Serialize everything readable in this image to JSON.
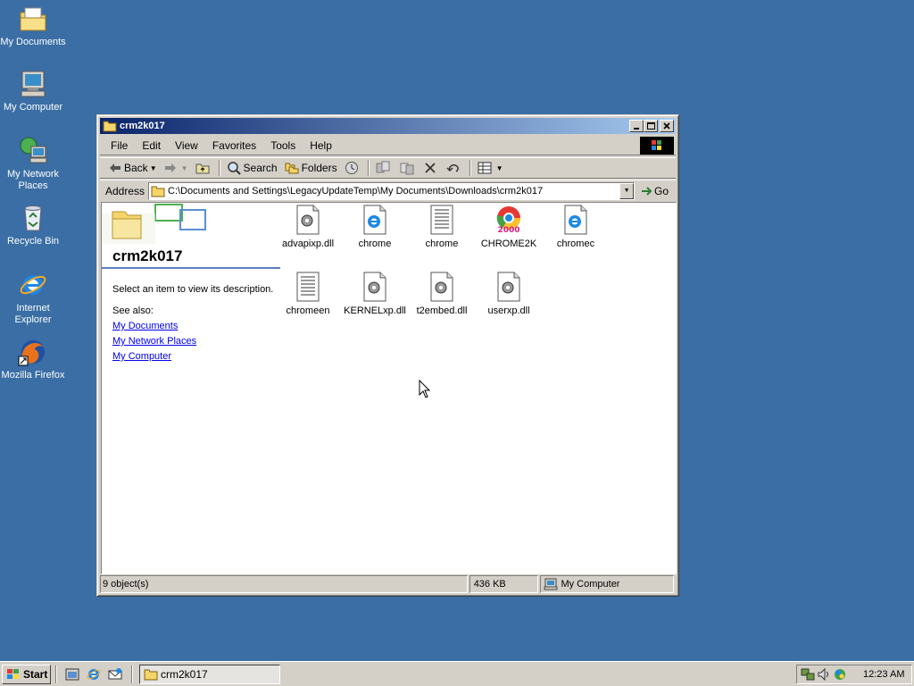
{
  "desktop": {
    "icons": [
      {
        "label": "My Documents",
        "icon": "my-documents-icon"
      },
      {
        "label": "My Computer",
        "icon": "my-computer-icon"
      },
      {
        "label": "My Network Places",
        "icon": "network-places-icon"
      },
      {
        "label": "Recycle Bin",
        "icon": "recycle-bin-icon"
      },
      {
        "label": "Internet Explorer",
        "icon": "internet-explorer-icon"
      },
      {
        "label": "Mozilla Firefox",
        "icon": "firefox-icon"
      }
    ]
  },
  "window": {
    "title": "crm2k017",
    "menu": [
      "File",
      "Edit",
      "View",
      "Favorites",
      "Tools",
      "Help"
    ],
    "toolbar": {
      "back": "Back",
      "search": "Search",
      "folders": "Folders"
    },
    "address": {
      "label": "Address",
      "value": "C:\\Documents and Settings\\LegacyUpdateTemp\\My Documents\\Downloads\\crm2k017",
      "go": "Go"
    },
    "leftpane": {
      "title": "crm2k017",
      "description": "Select an item to view its description.",
      "see_also": "See also:",
      "links": [
        "My Documents",
        "My Network Places",
        "My Computer"
      ]
    },
    "files": [
      {
        "name": "advapixp.dll",
        "icon": "dll-file-icon"
      },
      {
        "name": "chrome",
        "icon": "ie-html-file-icon"
      },
      {
        "name": "chrome",
        "icon": "text-file-icon"
      },
      {
        "name": "CHROME2K",
        "icon": "chrome2k-app-icon"
      },
      {
        "name": "chromec",
        "icon": "ie-html-file-icon"
      },
      {
        "name": "chromeen",
        "icon": "text-file-icon"
      },
      {
        "name": "KERNELxp.dll",
        "icon": "dll-file-icon"
      },
      {
        "name": "t2embed.dll",
        "icon": "dll-file-icon"
      },
      {
        "name": "userxp.dll",
        "icon": "dll-file-icon"
      }
    ],
    "status": {
      "objects": "9 object(s)",
      "size": "436 KB",
      "zone": "My Computer"
    }
  },
  "taskbar": {
    "start": "Start",
    "task": "crm2k017",
    "clock": "12:23 AM"
  },
  "colors": {
    "desktop": "#3a6ea5",
    "title_active": "#0a246a",
    "face": "#d4d0c8"
  }
}
